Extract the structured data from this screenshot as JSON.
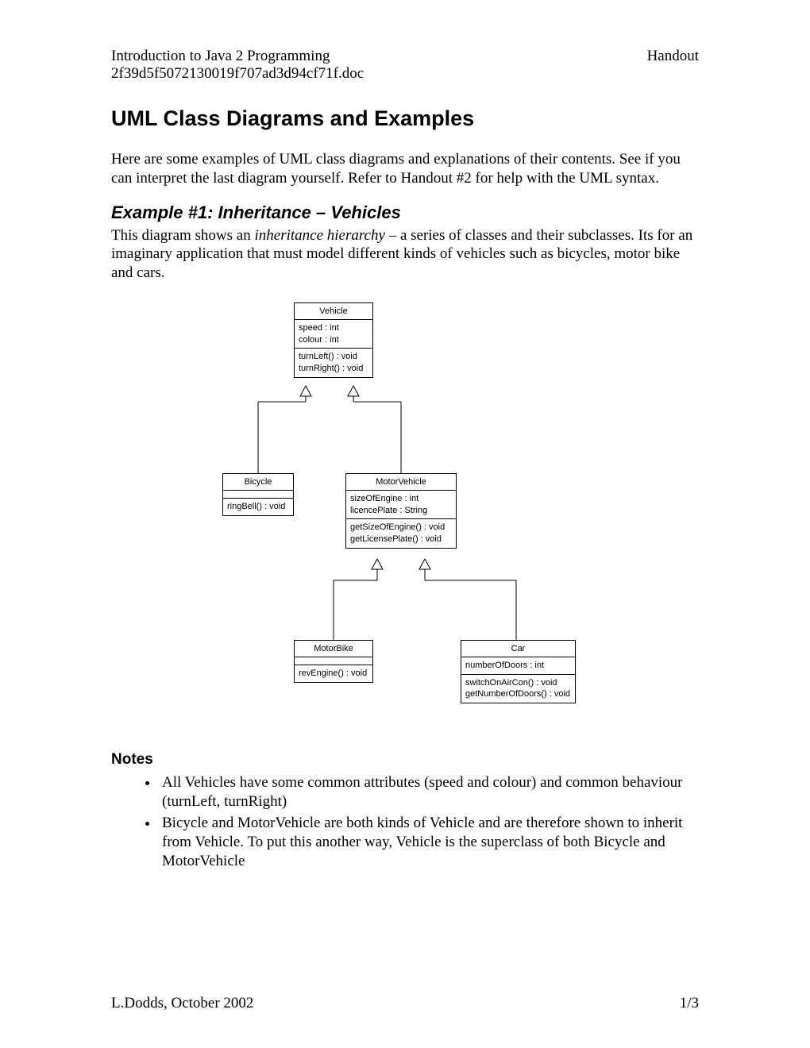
{
  "header": {
    "course": "Introduction to Java 2 Programming",
    "filename": "2f39d5f5072130019f707ad3d94cf71f.doc",
    "type": "Handout"
  },
  "title": "UML Class Diagrams and Examples",
  "intro": "Here are some examples of UML class diagrams and explanations of their contents. See if you can interpret the last diagram yourself. Refer to Handout #2 for help with the UML syntax.",
  "example1": {
    "heading": "Example #1: Inheritance – Vehicles",
    "text_before": "This diagram shows an ",
    "text_italic": "inheritance hierarchy",
    "text_after": " – a series of classes and their subclasses. Its for an imaginary application that must model different kinds of vehicles such as bicycles, motor bike and cars."
  },
  "uml": {
    "vehicle": {
      "name": "Vehicle",
      "attrs": [
        "speed : int",
        "colour : int"
      ],
      "methods": [
        "turnLeft() : void",
        "turnRight() : void"
      ]
    },
    "bicycle": {
      "name": "Bicycle",
      "attrs": [],
      "methods": [
        "ringBell() : void"
      ]
    },
    "motorvehicle": {
      "name": "MotorVehicle",
      "attrs": [
        "sizeOfEngine : int",
        "licencePlate : String"
      ],
      "methods": [
        "getSizeOfEngine() : void",
        "getLicensePlate() : void"
      ]
    },
    "motorbike": {
      "name": "MotorBike",
      "attrs": [],
      "methods": [
        "revEngine() : void"
      ]
    },
    "car": {
      "name": "Car",
      "attrs": [
        "numberOfDoors : int"
      ],
      "methods": [
        "switchOnAirCon() : void",
        "getNumberOfDoors() : void"
      ]
    }
  },
  "notes_heading": "Notes",
  "notes": [
    "All Vehicles have some common attributes (speed and colour) and common behaviour (turnLeft, turnRight)",
    "Bicycle and MotorVehicle are both kinds of Vehicle and are therefore shown to inherit from Vehicle. To put this another way, Vehicle is the superclass of both Bicycle and MotorVehicle"
  ],
  "footer": {
    "author": "L.Dodds, October 2002",
    "page": "1/3"
  }
}
